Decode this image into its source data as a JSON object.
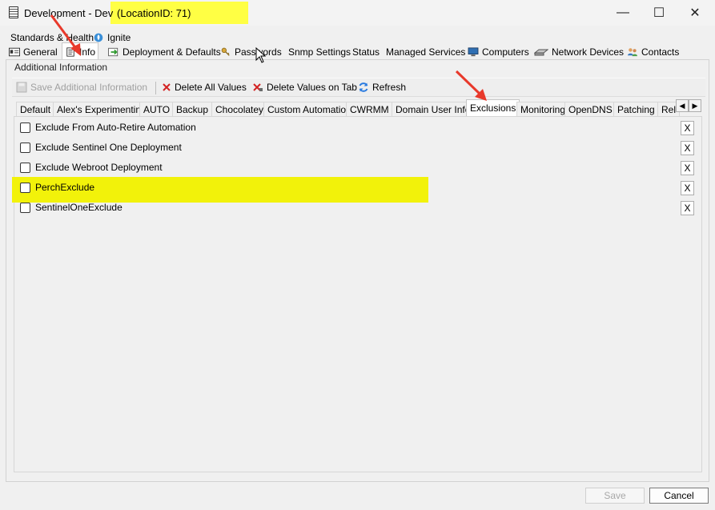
{
  "window": {
    "title": "Development - Dev",
    "location": "(LocationID: 71)",
    "controls": {
      "minimize": "—",
      "maximize": "☐",
      "close": "✕"
    }
  },
  "top_tabs_row1": [
    {
      "label": "Standards & Health",
      "icon": ""
    },
    {
      "label": "Ignite",
      "icon": "ignite-icon"
    }
  ],
  "top_tabs_row2": [
    {
      "label": "General",
      "icon": "id-card-icon",
      "selected": false
    },
    {
      "label": "Info",
      "icon": "document-icon",
      "selected": true
    },
    {
      "label": "Deployment & Defaults",
      "icon": "deploy-arrow-icon",
      "selected": false
    },
    {
      "label": "Passwords",
      "icon": "key-icon",
      "selected": false
    },
    {
      "label": "Snmp Settings",
      "icon": "",
      "selected": false
    },
    {
      "label": "Status",
      "icon": "",
      "selected": false
    },
    {
      "label": "Managed Services",
      "icon": "",
      "selected": false
    },
    {
      "label": "Computers",
      "icon": "computer-icon",
      "selected": false
    },
    {
      "label": "Network Devices",
      "icon": "network-device-icon",
      "selected": false
    },
    {
      "label": "Contacts",
      "icon": "contacts-icon",
      "selected": false
    }
  ],
  "panel": {
    "group_label": "Additional Information"
  },
  "toolbar": {
    "save": "Save Additional Information",
    "delete_all": "Delete All Values",
    "delete_tab": "Delete Values on Tab",
    "refresh": "Refresh"
  },
  "sub_tabs": [
    "Default",
    "Alex's Experimenting",
    "AUTO",
    "Backup",
    "Chocolatey",
    "Custom Automation",
    "CWRMM",
    "Domain User Info",
    "Exclusions",
    "Monitoring",
    "OpenDNS",
    "Patching",
    "Rel"
  ],
  "sub_tabs_selected": "Exclusions",
  "exclusions": [
    {
      "label": "Exclude From Auto-Retire Automation",
      "checked": false,
      "highlighted": false
    },
    {
      "label": "Exclude Sentinel One Deployment",
      "checked": false,
      "highlighted": false
    },
    {
      "label": "Exclude Webroot Deployment",
      "checked": false,
      "highlighted": false
    },
    {
      "label": "PerchExclude",
      "checked": false,
      "highlighted": true
    },
    {
      "label": "SentinelOneExclude",
      "checked": false,
      "highlighted": false
    }
  ],
  "clear_button_label": "X",
  "footer": {
    "save": "Save",
    "cancel": "Cancel"
  },
  "colors": {
    "highlight": "#f2f20a",
    "title_highlight": "#ffff44",
    "annotation_arrow": "#e8392b"
  }
}
